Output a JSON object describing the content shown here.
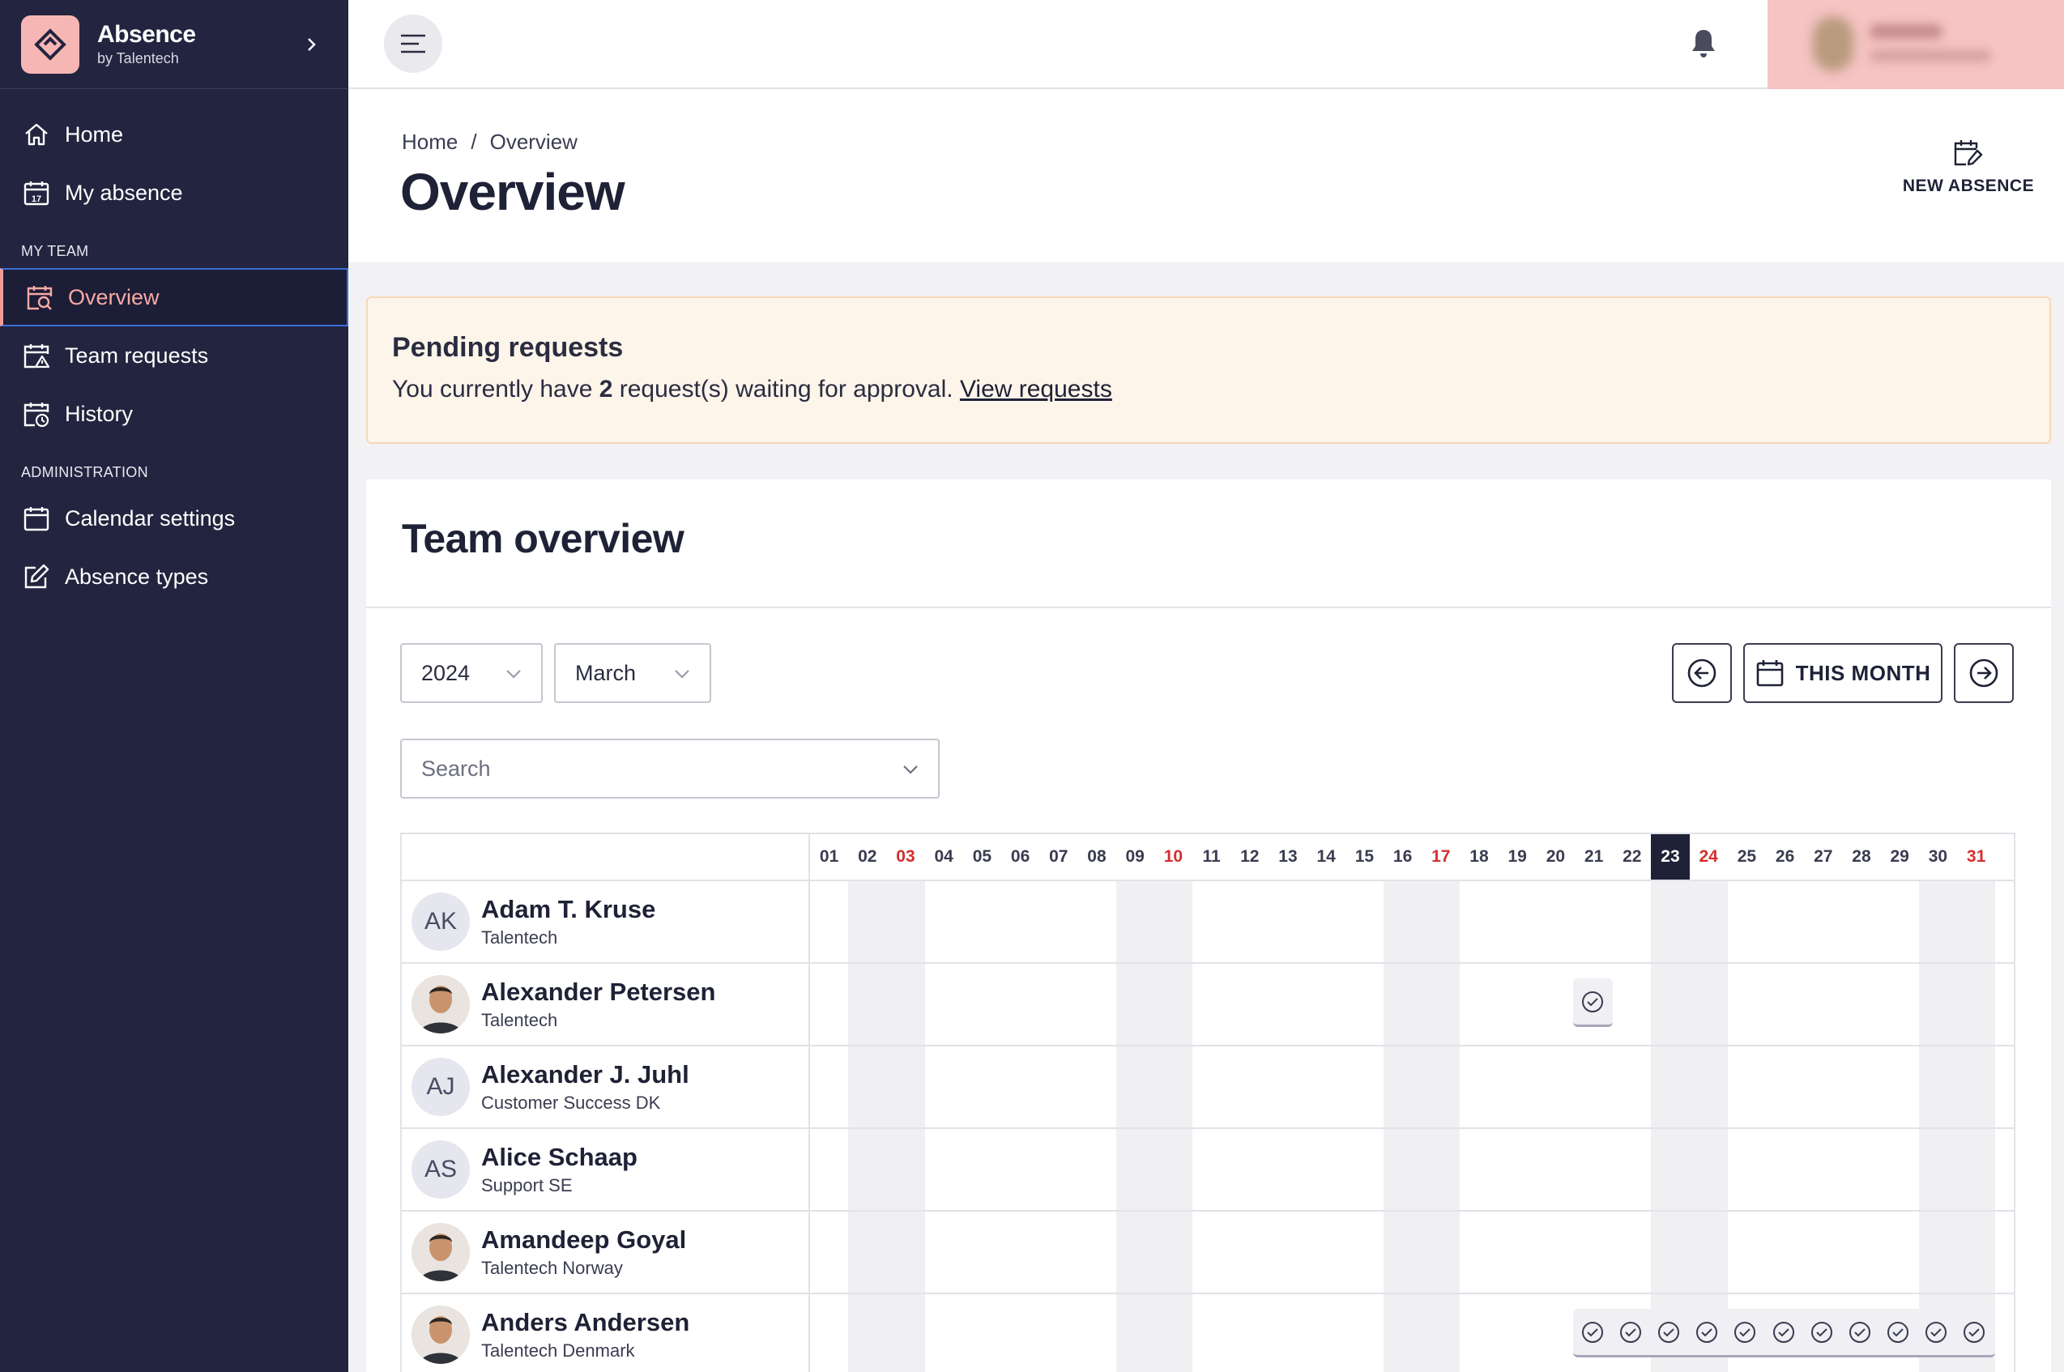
{
  "brand": {
    "name": "Absence",
    "sub": "by Talentech"
  },
  "sidebar": {
    "items_top": [
      {
        "label": "Home",
        "icon": "home-icon"
      },
      {
        "label": "My absence",
        "icon": "calendar-17-icon"
      }
    ],
    "section_team": "MY TEAM",
    "items_team": [
      {
        "label": "Overview",
        "icon": "calendar-search-icon",
        "active": true
      },
      {
        "label": "Team requests",
        "icon": "calendar-alert-icon"
      },
      {
        "label": "History",
        "icon": "calendar-clock-icon"
      }
    ],
    "section_admin": "ADMINISTRATION",
    "items_admin": [
      {
        "label": "Calendar settings",
        "icon": "calendar-icon"
      },
      {
        "label": "Absence types",
        "icon": "edit-icon"
      }
    ]
  },
  "breadcrumb": {
    "home": "Home",
    "sep": "/",
    "current": "Overview"
  },
  "page": {
    "title": "Overview",
    "new_absence": "NEW ABSENCE"
  },
  "pending": {
    "title": "Pending requests",
    "text_before": "You currently have ",
    "count": "2",
    "text_after": " request(s) waiting for approval. ",
    "link": "View requests"
  },
  "team": {
    "title": "Team overview",
    "year": "2024",
    "month": "March",
    "search_placeholder": "Search",
    "this_month": "THIS MONTH"
  },
  "calendar": {
    "days": [
      "01",
      "02",
      "03",
      "04",
      "05",
      "06",
      "07",
      "08",
      "09",
      "10",
      "11",
      "12",
      "13",
      "14",
      "15",
      "16",
      "17",
      "18",
      "19",
      "20",
      "21",
      "22",
      "23",
      "24",
      "25",
      "26",
      "27",
      "28",
      "29",
      "30",
      "31"
    ],
    "red_days": [
      "03",
      "10",
      "17",
      "24",
      "31"
    ],
    "today": "23",
    "shaded_days": [
      "02",
      "03",
      "09",
      "10",
      "16",
      "17",
      "23",
      "24",
      "30",
      "31"
    ]
  },
  "people": [
    {
      "name": "Adam T. Kruse",
      "org": "Talentech",
      "initials": "AK",
      "photo": false
    },
    {
      "name": "Alexander Petersen",
      "org": "Talentech",
      "initials": "",
      "photo": true
    },
    {
      "name": "Alexander J. Juhl",
      "org": "Customer Success DK",
      "initials": "AJ",
      "photo": false
    },
    {
      "name": "Alice Schaap",
      "org": "Support SE",
      "initials": "AS",
      "photo": false
    },
    {
      "name": "Amandeep Goyal",
      "org": "Talentech Norway",
      "initials": "",
      "photo": true
    },
    {
      "name": "Anders Andersen",
      "org": "Talentech Denmark",
      "initials": "",
      "photo": true
    }
  ],
  "absences": [
    {
      "person": "Alexander Petersen",
      "days": [
        "21"
      ]
    },
    {
      "person": "Anders Andersen",
      "days": [
        "21",
        "22",
        "23",
        "24",
        "25",
        "26",
        "27",
        "28",
        "29",
        "30",
        "31"
      ]
    }
  ],
  "colors": {
    "sidebar": "#23243f",
    "accent": "#f19c98",
    "today": "#1f2236",
    "weekend_red": "#d62e2e"
  }
}
